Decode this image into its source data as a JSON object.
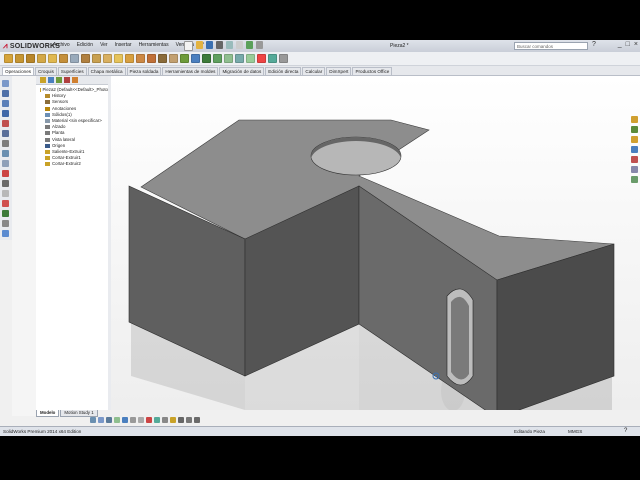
{
  "app": {
    "logo_text": "SOLIDWORKS",
    "document_title": "Pieza2 *",
    "search_placeholder": "Buscar comandos",
    "help_label": "?",
    "window_controls": [
      "_",
      "□",
      "×"
    ]
  },
  "menu": [
    "Archivo",
    "Edición",
    "Ver",
    "Insertar",
    "Herramientas",
    "Ventana",
    "?"
  ],
  "tabs": [
    {
      "label": "Operaciones",
      "active": true
    },
    {
      "label": "Croquis",
      "active": false
    },
    {
      "label": "Superficies",
      "active": false
    },
    {
      "label": "Chapa metálica",
      "active": false
    },
    {
      "label": "Pieza soldada",
      "active": false
    },
    {
      "label": "Herramientas de moldes",
      "active": false
    },
    {
      "label": "Migración de datos",
      "active": false
    },
    {
      "label": "Edición directa",
      "active": false
    },
    {
      "label": "Calcular",
      "active": false
    },
    {
      "label": "DimXpert",
      "active": false
    },
    {
      "label": "Productos Office",
      "active": false
    }
  ],
  "tree": [
    {
      "label": "Pieza2  (Default<<Default>_Photo",
      "icon": "part-icon",
      "color": "#c9a227",
      "indent": 0
    },
    {
      "label": "History",
      "icon": "history-icon",
      "color": "#b58b2a",
      "indent": 1
    },
    {
      "label": "Sensors",
      "icon": "sensors-icon",
      "color": "#8a6d3b",
      "indent": 1
    },
    {
      "label": "Anotaciones",
      "icon": "annotations-icon",
      "color": "#b8860b",
      "indent": 1
    },
    {
      "label": "Sólidos(1)",
      "icon": "solid-bodies-icon",
      "color": "#6b8fb5",
      "indent": 1
    },
    {
      "label": "Material <sin especificar>",
      "icon": "material-icon",
      "color": "#8899aa",
      "indent": 1
    },
    {
      "label": "Alzado",
      "icon": "plane-icon",
      "color": "#7a7a7a",
      "indent": 1
    },
    {
      "label": "Planta",
      "icon": "plane-icon",
      "color": "#7a7a7a",
      "indent": 1
    },
    {
      "label": "Vista lateral",
      "icon": "plane-icon",
      "color": "#7a7a7a",
      "indent": 1
    },
    {
      "label": "Origen",
      "icon": "origin-icon",
      "color": "#3b5b8a",
      "indent": 1
    },
    {
      "label": "Saliente-Extruir1",
      "icon": "extrude-icon",
      "color": "#c9a227",
      "indent": 1
    },
    {
      "label": "Cortar-Extruir1",
      "icon": "cut-extrude-icon",
      "color": "#c9a227",
      "indent": 1
    },
    {
      "label": "Cortar-Extruir2",
      "icon": "cut-extrude-icon",
      "color": "#c9a227",
      "indent": 1
    }
  ],
  "bottom_tabs": [
    {
      "label": "Modelo",
      "active": true
    },
    {
      "label": "Motion Study 1",
      "active": false
    }
  ],
  "status": {
    "product": "SolidWorks Premium 2014 x64 Edition",
    "mode": "Editando Pieza",
    "units": "MMGS",
    "help": "?"
  },
  "colors": {
    "face_top": "#8d8d8d",
    "face_front": "#5f5f5f",
    "face_side": "#4b4b4b",
    "accent_red": "#c8102e"
  }
}
